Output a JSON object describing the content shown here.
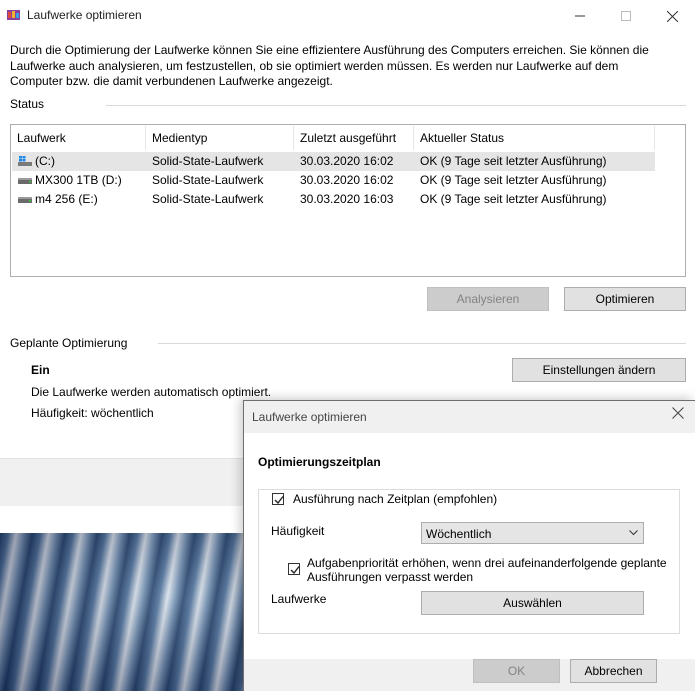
{
  "window": {
    "title": "Laufwerke optimieren",
    "intro": "Durch die Optimierung der Laufwerke können Sie eine effizientere Ausführung des Computers erreichen. Sie können die Laufwerke auch analysieren, um festzustellen, ob sie optimiert werden müssen. Es werden nur Laufwerke auf dem Computer bzw. die damit verbundenen Laufwerke angezeigt.",
    "status_label": "Status",
    "columns": [
      "Laufwerk",
      "Medientyp",
      "Zuletzt ausgeführt",
      "Aktueller Status"
    ],
    "drives": [
      {
        "name": "(C:)",
        "type": "Solid-State-Laufwerk",
        "last_run": "30.03.2020 16:02",
        "status": "OK (9 Tage seit letzter Ausführung)",
        "icon": "windows-drive-icon"
      },
      {
        "name": "MX300 1TB (D:)",
        "type": "Solid-State-Laufwerk",
        "last_run": "30.03.2020 16:02",
        "status": "OK (9 Tage seit letzter Ausführung)",
        "icon": "drive-icon"
      },
      {
        "name": "m4 256 (E:)",
        "type": "Solid-State-Laufwerk",
        "last_run": "30.03.2020 16:03",
        "status": "OK (9 Tage seit letzter Ausführung)",
        "icon": "drive-icon"
      }
    ],
    "analyze_button": "Analysieren",
    "optimize_button": "Optimieren",
    "scheduled_label": "Geplante Optimierung",
    "schedule_state": "Ein",
    "schedule_desc": "Die Laufwerke werden automatisch optimiert.",
    "frequency_text": "Häufigkeit: wöchentlich",
    "change_settings_button": "Einstellungen ändern"
  },
  "dialog": {
    "title": "Laufwerke optimieren",
    "heading": "Optimierungszeitplan",
    "schedule_checkbox_label": "Ausführung nach Zeitplan (empfohlen)",
    "schedule_checked": true,
    "frequency_label": "Häufigkeit",
    "frequency_value": "Wöchentlich",
    "priority_checkbox_label_line1": "Aufgabenpriorität erhöhen, wenn drei aufeinanderfolgende geplante",
    "priority_checkbox_label_line2": "Ausführungen verpasst werden",
    "priority_checked": true,
    "drives_label": "Laufwerke",
    "choose_button": "Auswählen",
    "ok_button": "OK",
    "cancel_button": "Abbrechen"
  }
}
